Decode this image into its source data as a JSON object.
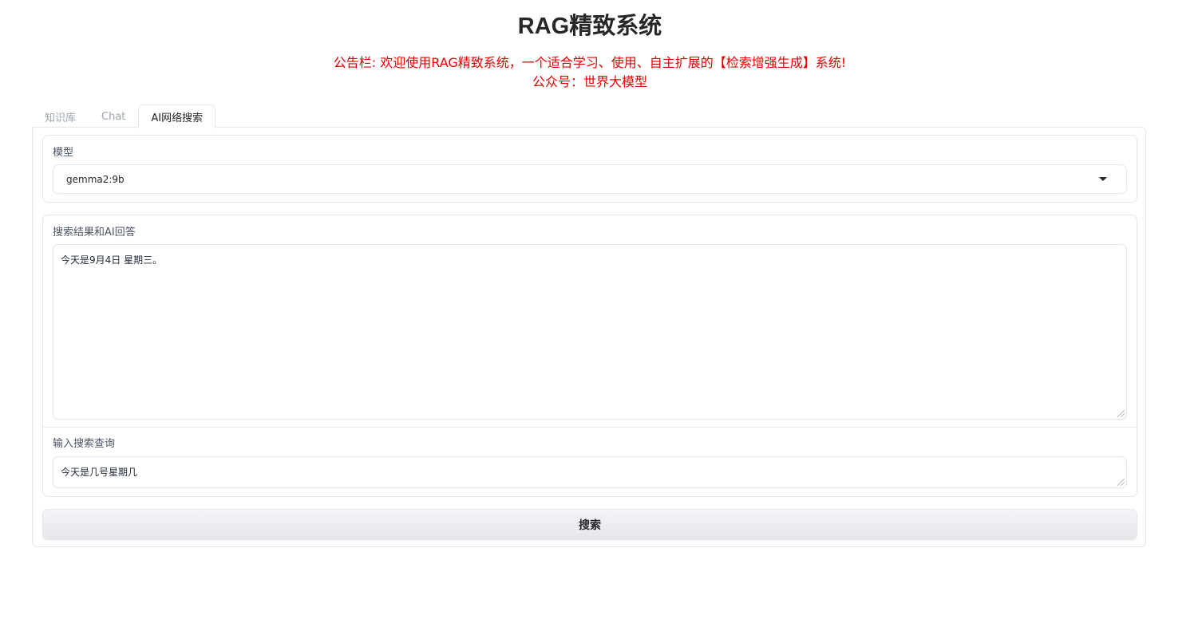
{
  "app": {
    "title": "RAG精致系统",
    "notice_line1": "公告栏: 欢迎使用RAG精致系统，一个适合学习、使用、自主扩展的【检索增强生成】系统!",
    "notice_line2": "公众号：世界大模型",
    "notice_color": "#e30000"
  },
  "tabs": [
    {
      "label": "知识库",
      "active": false
    },
    {
      "label": "Chat",
      "active": false
    },
    {
      "label": "AI网络搜索",
      "active": true
    }
  ],
  "model": {
    "label": "模型",
    "selected": "gemma2:9b"
  },
  "results": {
    "label": "搜索结果和AI回答",
    "value": "今天是9月4日 星期三。"
  },
  "query": {
    "label": "输入搜索查询",
    "value": "今天是几号星期几"
  },
  "search_button": {
    "label": "搜索"
  }
}
